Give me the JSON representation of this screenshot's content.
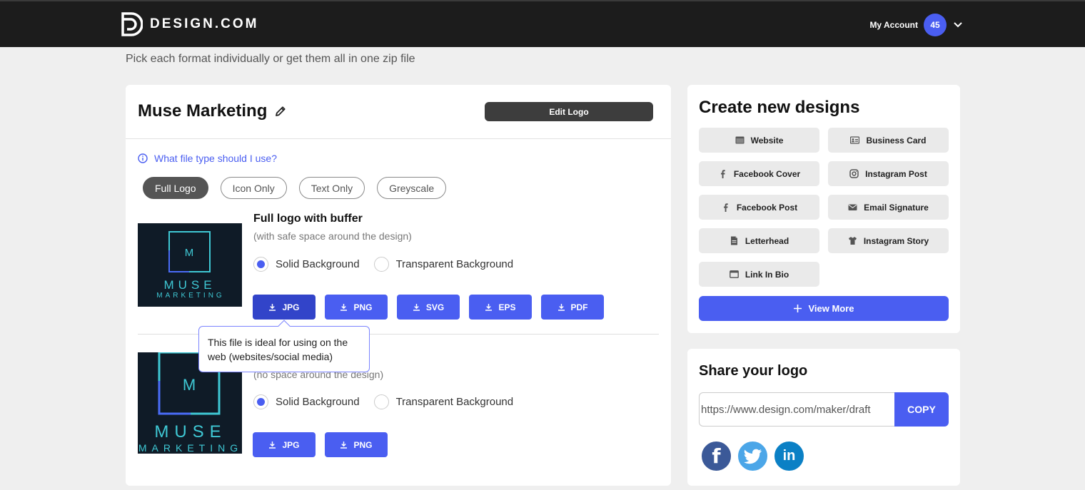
{
  "header": {
    "brand": "DESIGN.COM",
    "account_label": "My Account",
    "account_badge": "45"
  },
  "subtitle": "Pick each format individually or get them all in one zip file",
  "logo": {
    "name": "Muse Marketing",
    "edit_label": "Edit Logo",
    "help_text": "What file type should I use?",
    "mark_letter": "M",
    "word_top": "MUSE",
    "word_bottom": "MARKETING"
  },
  "logo_types": [
    "Full Logo",
    "Icon Only",
    "Text Only",
    "Greyscale"
  ],
  "options": [
    {
      "title": "Full logo with buffer",
      "subtitle": "(with safe space around the design)",
      "bg_solid": "Solid Background",
      "bg_transparent": "Transparent Background",
      "formats": [
        "JPG",
        "PNG",
        "SVG",
        "EPS",
        "PDF"
      ]
    },
    {
      "subtitle": "(no space around the design)",
      "bg_solid": "Solid Background",
      "bg_transparent": "Transparent Background",
      "formats": [
        "JPG",
        "PNG"
      ]
    }
  ],
  "tooltip": "This file is ideal for using on the web (websites/social media)",
  "create": {
    "heading": "Create new designs",
    "items": [
      {
        "label": "Website",
        "icon": "browser-icon"
      },
      {
        "label": "Business Card",
        "icon": "id-card-icon"
      },
      {
        "label": "Facebook Cover",
        "icon": "facebook-icon"
      },
      {
        "label": "Instagram Post",
        "icon": "instagram-icon"
      },
      {
        "label": "Facebook Post",
        "icon": "facebook-icon"
      },
      {
        "label": "Email Signature",
        "icon": "envelope-icon"
      },
      {
        "label": "Letterhead",
        "icon": "document-icon"
      },
      {
        "label": "Instagram Story",
        "icon": "tshirt-icon"
      },
      {
        "label": "Link In Bio",
        "icon": "link-window-icon"
      }
    ],
    "view_more": "View More"
  },
  "share": {
    "heading": "Share your logo",
    "url": "https://www.design.com/maker/draft",
    "copy_label": "COPY",
    "facebook": "f",
    "linkedin": "in"
  },
  "colors": {
    "accent": "#4a5ef1",
    "topbar": "#1c1c1c",
    "logo_bg": "#0f1b27",
    "logo_cyan": "#3fc8d4",
    "logo_blue": "#4a6cf7"
  }
}
